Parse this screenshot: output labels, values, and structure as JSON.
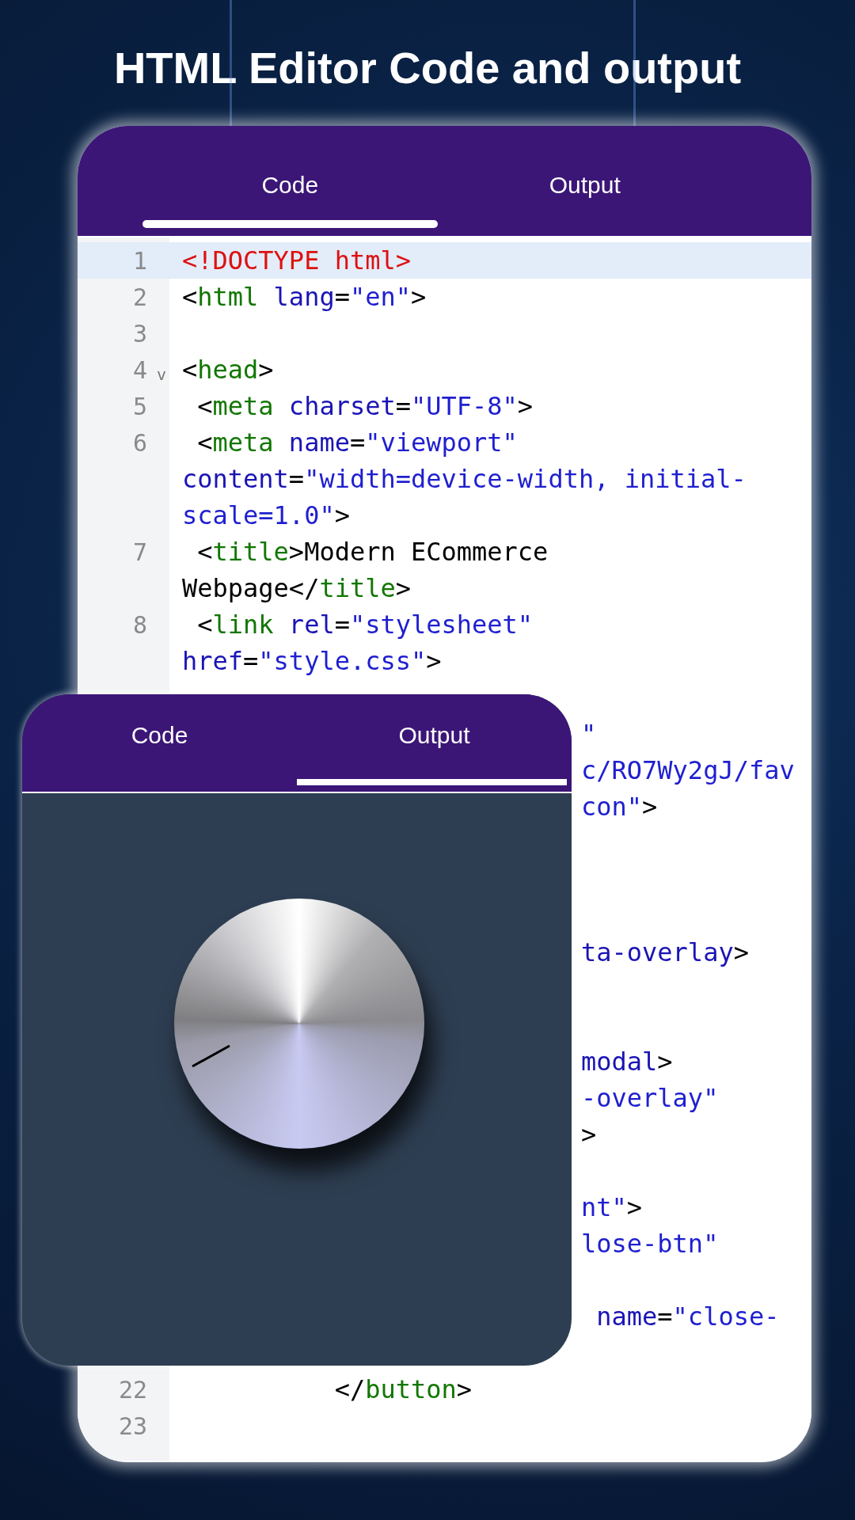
{
  "headline": "HTML Editor Code and output",
  "editor": {
    "tabs": [
      {
        "label": "Code",
        "selected": true
      },
      {
        "label": "Output",
        "selected": false
      }
    ],
    "rows": [
      {
        "number": "1",
        "selected": true,
        "segments": [
          {
            "kind": "doctype",
            "text": "<!DOCTYPE html>"
          }
        ]
      },
      {
        "number": "2",
        "selected": false,
        "segments": [
          {
            "kind": "punct",
            "text": "<"
          },
          {
            "kind": "tag",
            "text": "html"
          },
          {
            "kind": "attr",
            "text": " lang"
          },
          {
            "kind": "punct",
            "text": "="
          },
          {
            "kind": "string",
            "text": "\"en\""
          },
          {
            "kind": "punct",
            "text": ">"
          }
        ]
      },
      {
        "number": "3",
        "selected": false,
        "segments": []
      },
      {
        "number": "4",
        "fold": "v",
        "selected": false,
        "segments": [
          {
            "kind": "punct",
            "text": "<"
          },
          {
            "kind": "tag",
            "text": "head"
          },
          {
            "kind": "punct",
            "text": ">"
          }
        ]
      },
      {
        "number": "5",
        "selected": false,
        "segments": [
          {
            "kind": "punct",
            "text": " <"
          },
          {
            "kind": "tag",
            "text": "meta"
          },
          {
            "kind": "attr",
            "text": " charset"
          },
          {
            "kind": "punct",
            "text": "="
          },
          {
            "kind": "string",
            "text": "\"UTF-8\""
          },
          {
            "kind": "punct",
            "text": ">"
          }
        ]
      },
      {
        "number": "6",
        "selected": false,
        "segments": [
          {
            "kind": "punct",
            "text": " <"
          },
          {
            "kind": "tag",
            "text": "meta"
          },
          {
            "kind": "attr",
            "text": " name"
          },
          {
            "kind": "punct",
            "text": "="
          },
          {
            "kind": "string",
            "text": "\"viewport\""
          }
        ]
      },
      {
        "selected": false,
        "segments": [
          {
            "kind": "attr",
            "text": "content"
          },
          {
            "kind": "punct",
            "text": "="
          },
          {
            "kind": "string",
            "text": "\"width=device-width, initial-"
          }
        ]
      },
      {
        "selected": false,
        "segments": [
          {
            "kind": "string",
            "text": "scale=1.0\""
          },
          {
            "kind": "punct",
            "text": ">"
          }
        ]
      },
      {
        "number": "7",
        "selected": false,
        "segments": [
          {
            "kind": "punct",
            "text": " <"
          },
          {
            "kind": "tag",
            "text": "title"
          },
          {
            "kind": "punct",
            "text": ">"
          },
          {
            "kind": "text",
            "text": "Modern ECommerce"
          }
        ]
      },
      {
        "selected": false,
        "segments": [
          {
            "kind": "text",
            "text": "Webpage"
          },
          {
            "kind": "punct",
            "text": "</"
          },
          {
            "kind": "tag",
            "text": "title"
          },
          {
            "kind": "punct",
            "text": ">"
          }
        ]
      },
      {
        "number": "8",
        "selected": false,
        "segments": [
          {
            "kind": "punct",
            "text": " <"
          },
          {
            "kind": "tag",
            "text": "link"
          },
          {
            "kind": "attr",
            "text": " rel"
          },
          {
            "kind": "punct",
            "text": "="
          },
          {
            "kind": "string",
            "text": "\"stylesheet\""
          }
        ]
      },
      {
        "selected": false,
        "segments": [
          {
            "kind": "attr",
            "text": "href"
          },
          {
            "kind": "punct",
            "text": "="
          },
          {
            "kind": "string",
            "text": "\"style.css\""
          },
          {
            "kind": "punct",
            "text": ">"
          }
        ]
      },
      {
        "kind": "covered",
        "selected": false,
        "segments": []
      },
      {
        "kind": "covered",
        "selected": false,
        "segments": [
          {
            "kind": "string",
            "text": "\""
          }
        ]
      },
      {
        "kind": "covered",
        "selected": false,
        "segments": [
          {
            "kind": "string",
            "text": "c/RO7Wy2gJ/fav"
          }
        ]
      },
      {
        "kind": "covered",
        "selected": false,
        "segments": [
          {
            "kind": "string",
            "text": "con\""
          },
          {
            "kind": "punct",
            "text": ">"
          }
        ]
      },
      {
        "kind": "covered",
        "selected": false,
        "segments": []
      },
      {
        "kind": "covered",
        "selected": false,
        "segments": []
      },
      {
        "kind": "covered",
        "selected": false,
        "segments": []
      },
      {
        "kind": "covered",
        "selected": false,
        "segments": [
          {
            "kind": "attr",
            "text": "ta-overlay"
          },
          {
            "kind": "punct",
            "text": ">"
          }
        ]
      },
      {
        "kind": "covered",
        "selected": false,
        "segments": []
      },
      {
        "kind": "covered",
        "selected": false,
        "segments": []
      },
      {
        "kind": "covered",
        "selected": false,
        "segments": [
          {
            "kind": "attr",
            "text": "modal"
          },
          {
            "kind": "punct",
            "text": ">"
          }
        ]
      },
      {
        "kind": "covered",
        "selected": false,
        "segments": [
          {
            "kind": "string",
            "text": "-overlay\""
          }
        ]
      },
      {
        "kind": "covered",
        "selected": false,
        "segments": [
          {
            "kind": "punct",
            "text": ">"
          }
        ]
      },
      {
        "kind": "covered",
        "selected": false,
        "segments": []
      },
      {
        "kind": "covered",
        "selected": false,
        "segments": [
          {
            "kind": "string",
            "text": "nt\""
          },
          {
            "kind": "punct",
            "text": ">"
          }
        ]
      },
      {
        "kind": "covered",
        "selected": false,
        "segments": [
          {
            "kind": "string",
            "text": "lose-btn\""
          }
        ]
      },
      {
        "kind": "covered",
        "selected": false,
        "segments": []
      },
      {
        "kind": "covered",
        "selected": false,
        "segments": [
          {
            "kind": "attr",
            "text": " name"
          },
          {
            "kind": "punct",
            "text": "="
          },
          {
            "kind": "string",
            "text": "\"close-"
          }
        ]
      },
      {
        "kind": "covered",
        "selected": false,
        "segments": []
      },
      {
        "number": "22",
        "selected": false,
        "segments": [
          {
            "kind": "punct",
            "text": "          </"
          },
          {
            "kind": "tag",
            "text": "button"
          },
          {
            "kind": "punct",
            "text": ">"
          }
        ]
      },
      {
        "number": "23",
        "selected": false,
        "segments": []
      }
    ]
  },
  "output_window": {
    "tabs": [
      {
        "label": "Code",
        "selected": false
      },
      {
        "label": "Output",
        "selected": true
      }
    ]
  }
}
